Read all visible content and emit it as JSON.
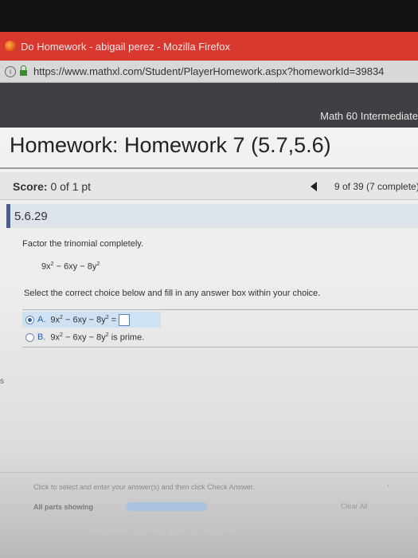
{
  "window": {
    "title": "Do Homework - abigail perez - Mozilla Firefox",
    "url": "https://www.mathxl.com/Student/PlayerHomework.aspx?homeworkId=39834"
  },
  "course": {
    "title": "Math 60 Intermediate"
  },
  "homework": {
    "title": "Homework: Homework 7 (5.7,5.6)",
    "score_label": "Score:",
    "score_value": "0 of 1 pt",
    "progress": "9 of 39 (7 complete)"
  },
  "question": {
    "number": "5.6.29",
    "instruction": "Factor the trinomial completely.",
    "expression": {
      "t1": "9x",
      "e1": "2",
      "t2": " − 6xy − 8y",
      "e2": "2"
    },
    "select_text": "Select the correct choice below and fill in any answer box within your choice.",
    "choices": [
      {
        "letter": "A.",
        "t1": "9x",
        "e1": "2",
        "t2": " − 6xy − 8y",
        "e2": "2",
        "t3": " =",
        "selected": true
      },
      {
        "letter": "B.",
        "t1": "9x",
        "e1": "2",
        "t2": " − 6xy − 8y",
        "e2": "2",
        "t3": " is prime.",
        "selected": false
      }
    ]
  },
  "sidebar_edge_text": "s",
  "footer": {
    "instruction": "Click to select and enter your answer(s) and then click Check Answer.",
    "trailing_mark": "·",
    "parts_label": "All parts showing",
    "parts_fraction": 1,
    "clear_all": "Clear All",
    "study_plan": "To see what to study next, go to your Study Plan."
  },
  "colors": {
    "title_bar": "#d9382f",
    "nav_bar": "#3f4043",
    "question_accent": "#4a5f86",
    "selected_choice": "#cfe2f4"
  },
  "icons": [
    "firefox-icon",
    "info-icon",
    "lock-icon",
    "prev-arrow-icon",
    "radio-icon"
  ]
}
